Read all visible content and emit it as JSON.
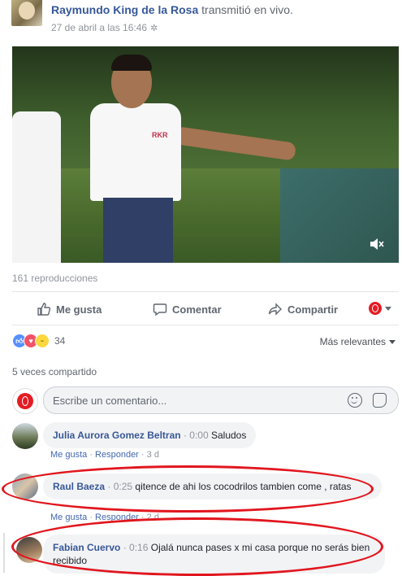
{
  "header": {
    "author": "Raymundo King de la Rosa",
    "action": "transmitió en vivo.",
    "timestamp": "27 de abril a las 16:46",
    "privacy_icon": "gear-globe-icon"
  },
  "video": {
    "mute_icon": "volume-mute-icon",
    "shirt_logo": "RKR"
  },
  "views": "161 reproducciones",
  "actions": {
    "like": "Me gusta",
    "comment": "Comentar",
    "share": "Compartir"
  },
  "reactions": {
    "count": "34",
    "sort_label": "Más relevantes"
  },
  "shares": "5 veces compartido",
  "composer": {
    "placeholder": "Escribe un comentario..."
  },
  "comments": [
    {
      "name": "Julia Aurora Gomez Beltran",
      "time": "0:00",
      "text": "Saludos",
      "like": "Me gusta",
      "reply": "Responder",
      "age": "3 d"
    },
    {
      "name": "Raul Baeza",
      "time": "0:25",
      "text": "qitence de ahi los cocodrilos tambien come , ratas",
      "like": "Me gusta",
      "reply": "Responder",
      "age": "2 d"
    },
    {
      "name": "Fabian Cuervo",
      "time": "0:16",
      "text": "Ojalá nunca pases x mi casa porque no serás bien recibido"
    }
  ],
  "colors": {
    "link": "#365899",
    "highlight": "#e1161e",
    "like_reaction": "#5890ff",
    "love_reaction": "#f25268",
    "haha_reaction": "#fcd83e"
  }
}
